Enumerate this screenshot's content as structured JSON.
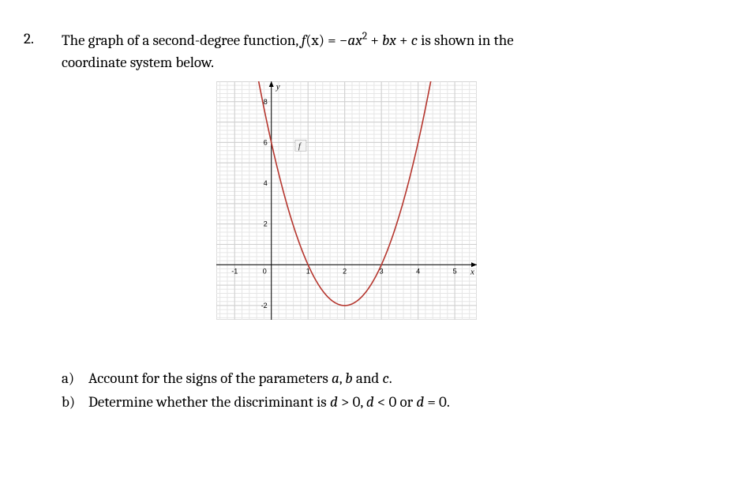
{
  "problem": {
    "number": "2.",
    "stem_part1": "The graph of a second-degree function, ",
    "stem_formula_fx": "f",
    "stem_formula_paren_x": "(x)",
    "stem_formula_eq": " = −",
    "stem_formula_ax2_a": "a",
    "stem_formula_ax2_x": "x",
    "stem_formula_ax2_exp": "2",
    "stem_formula_bx_plus": " + ",
    "stem_formula_bx_b": "b",
    "stem_formula_bx_x": "x",
    "stem_formula_c_plus": " + ",
    "stem_formula_c": "c",
    "stem_part2": " is shown in the",
    "stem_line2": "coordinate system below."
  },
  "subparts": {
    "a_letter": "a)",
    "a_text1": "Account for the signs of the parameters ",
    "a_a": "a",
    "a_comma": ", ",
    "a_b": "b",
    "a_and": " and ",
    "a_c": "c",
    "a_period": ".",
    "b_letter": "b)",
    "b_text1": "Determine whether the discriminant is  ",
    "b_d1": "d",
    "b_gt": " > 0, ",
    "b_d2": "d",
    "b_lt": " < 0 or  ",
    "b_d3": "d",
    "b_eq": " = 0."
  },
  "chart_data": {
    "type": "line",
    "title": "",
    "xlabel": "x",
    "ylabel": "y",
    "curve_label": "f",
    "xlim": [
      -1.5,
      5.6
    ],
    "ylim": [
      -2.7,
      9.0
    ],
    "x_ticks": [
      -1,
      0,
      1,
      2,
      3,
      4,
      5
    ],
    "y_ticks": [
      -2,
      2,
      4,
      6,
      8
    ],
    "zero_label": "0",
    "series": [
      {
        "name": "f",
        "formula_note": "Upward parabola with vertex approx (2, -2), roots approx x=1 and x=3, y-intercept approx 6",
        "points": [
          {
            "x": -0.4,
            "y": 9.0
          },
          {
            "x": 0.0,
            "y": 6.0
          },
          {
            "x": 0.5,
            "y": 2.5
          },
          {
            "x": 1.0,
            "y": 0.0
          },
          {
            "x": 1.5,
            "y": -1.5
          },
          {
            "x": 2.0,
            "y": -2.0
          },
          {
            "x": 2.5,
            "y": -1.5
          },
          {
            "x": 3.0,
            "y": 0.0
          },
          {
            "x": 3.5,
            "y": 2.5
          },
          {
            "x": 4.0,
            "y": 6.0
          },
          {
            "x": 4.4,
            "y": 9.0
          }
        ]
      }
    ]
  }
}
